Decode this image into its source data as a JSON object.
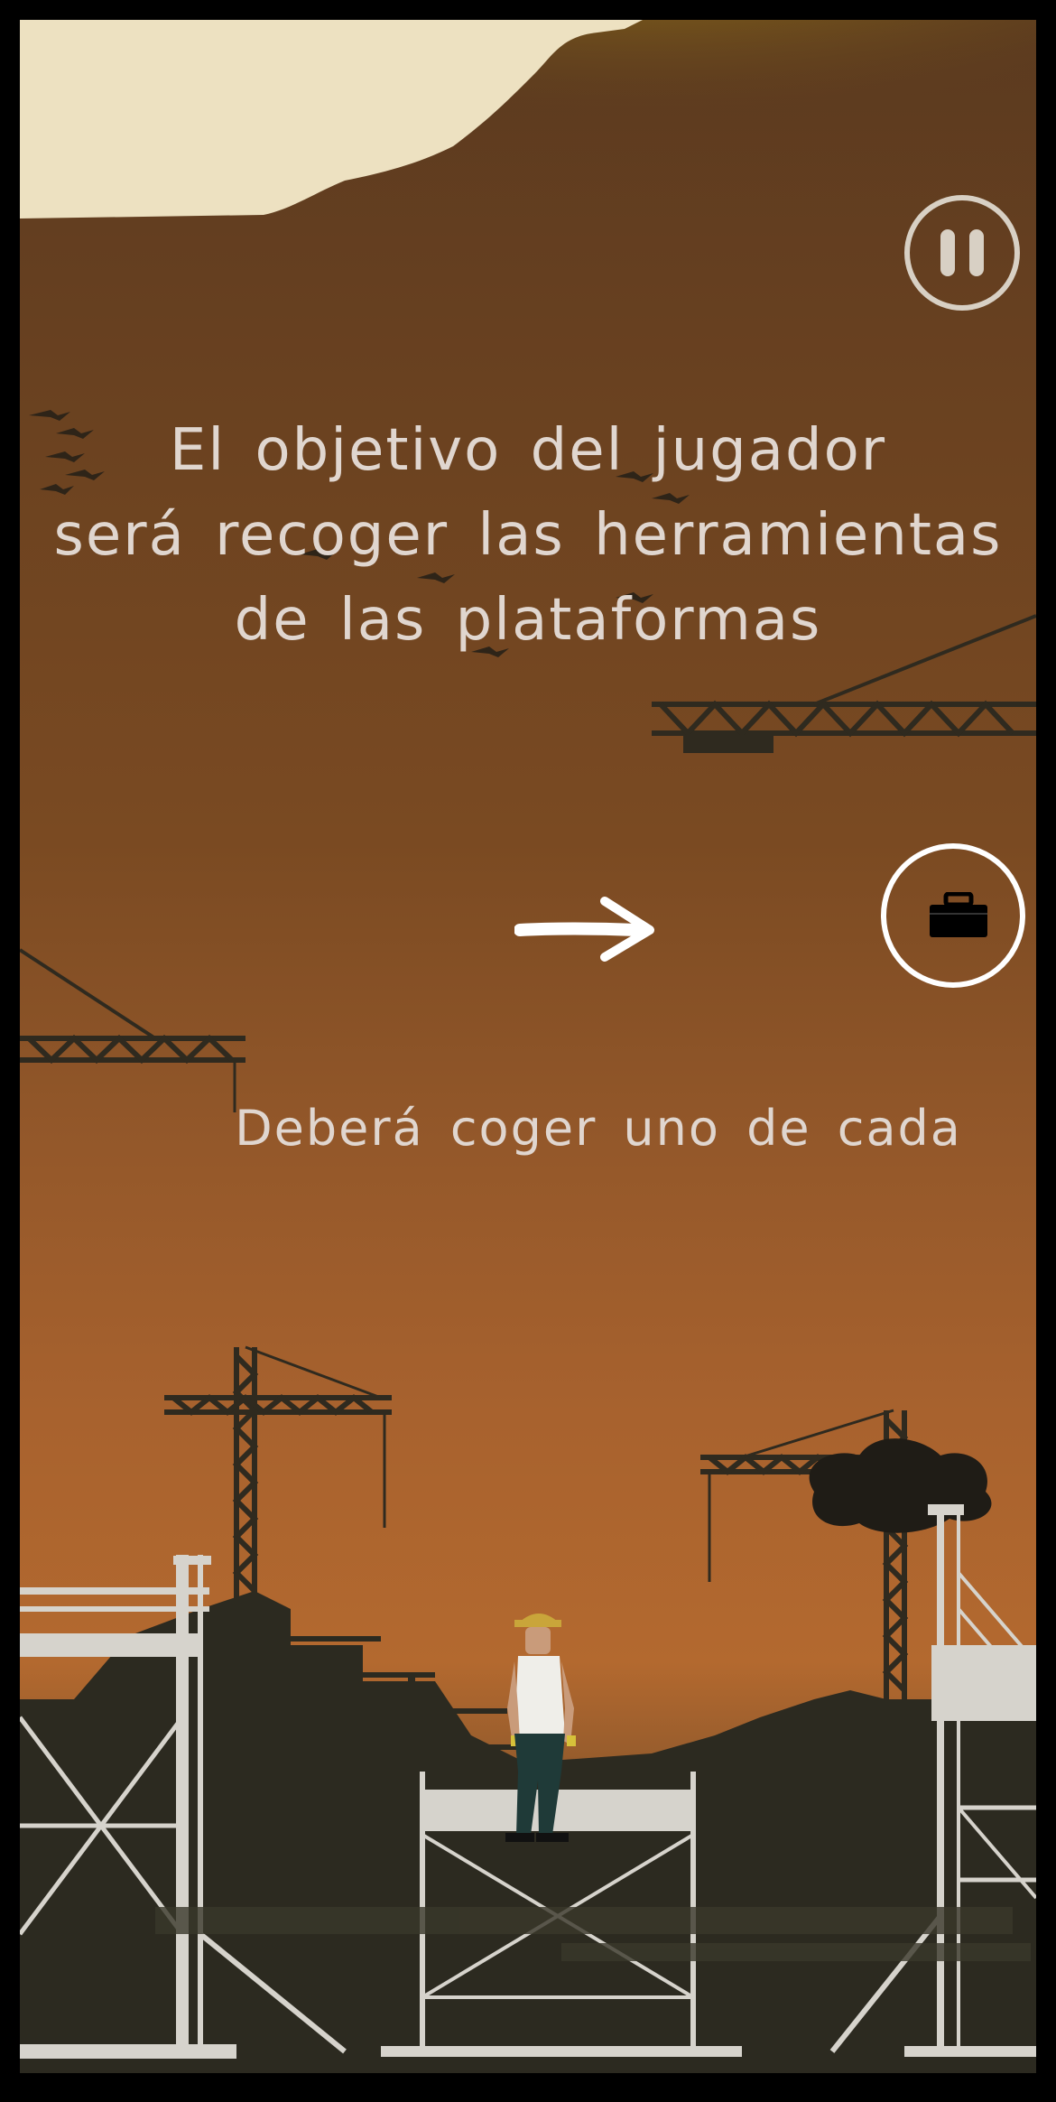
{
  "tutorial": {
    "title": "El objetivo del jugador\nserá recoger las herramientas\nde las plataformas",
    "subtitle": "Deberá coger uno de cada"
  },
  "icons": {
    "pause": "pause-icon",
    "arrow": "arrow-right-icon",
    "tool": "toolbox-icon"
  },
  "colors": {
    "sky_top": "#5b3a1f",
    "sky_bottom": "#b3692f",
    "sun_glow": "#d7b80c",
    "cloud": "#ede1c1",
    "silhouette": "#2c2a20",
    "scaffold": "#d6d3cc",
    "text": "#e0d6cf"
  }
}
